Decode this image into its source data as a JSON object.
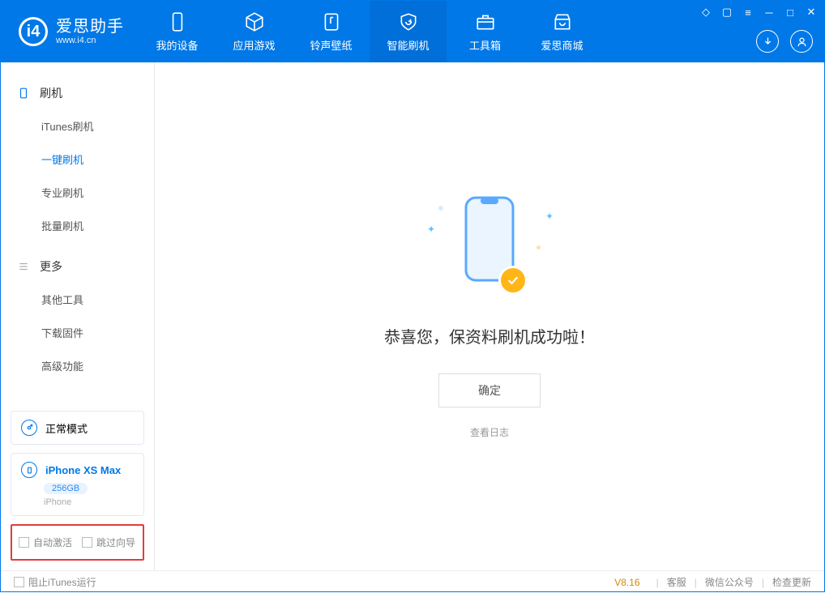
{
  "app": {
    "name": "爱思助手",
    "url": "www.i4.cn"
  },
  "tabs": {
    "device": "我的设备",
    "apps": "应用游戏",
    "ringtone": "铃声壁纸",
    "flash": "智能刷机",
    "toolbox": "工具箱",
    "store": "爱思商城"
  },
  "sidebar": {
    "group1": "刷机",
    "items1": {
      "itunes": "iTunes刷机",
      "oneclick": "一键刷机",
      "pro": "专业刷机",
      "batch": "批量刷机"
    },
    "group2": "更多",
    "items2": {
      "othertools": "其他工具",
      "firmware": "下载固件",
      "advanced": "高级功能"
    }
  },
  "device": {
    "mode": "正常模式",
    "name": "iPhone XS Max",
    "capacity": "256GB",
    "type": "iPhone"
  },
  "options": {
    "autoactivate": "自动激活",
    "skipwizard": "跳过向导"
  },
  "main": {
    "title": "恭喜您，保资料刷机成功啦！",
    "confirm": "确定",
    "viewlog": "查看日志"
  },
  "statusbar": {
    "blockitunes": "阻止iTunes运行",
    "version": "V8.16",
    "support": "客服",
    "wechat": "微信公众号",
    "update": "检查更新"
  }
}
